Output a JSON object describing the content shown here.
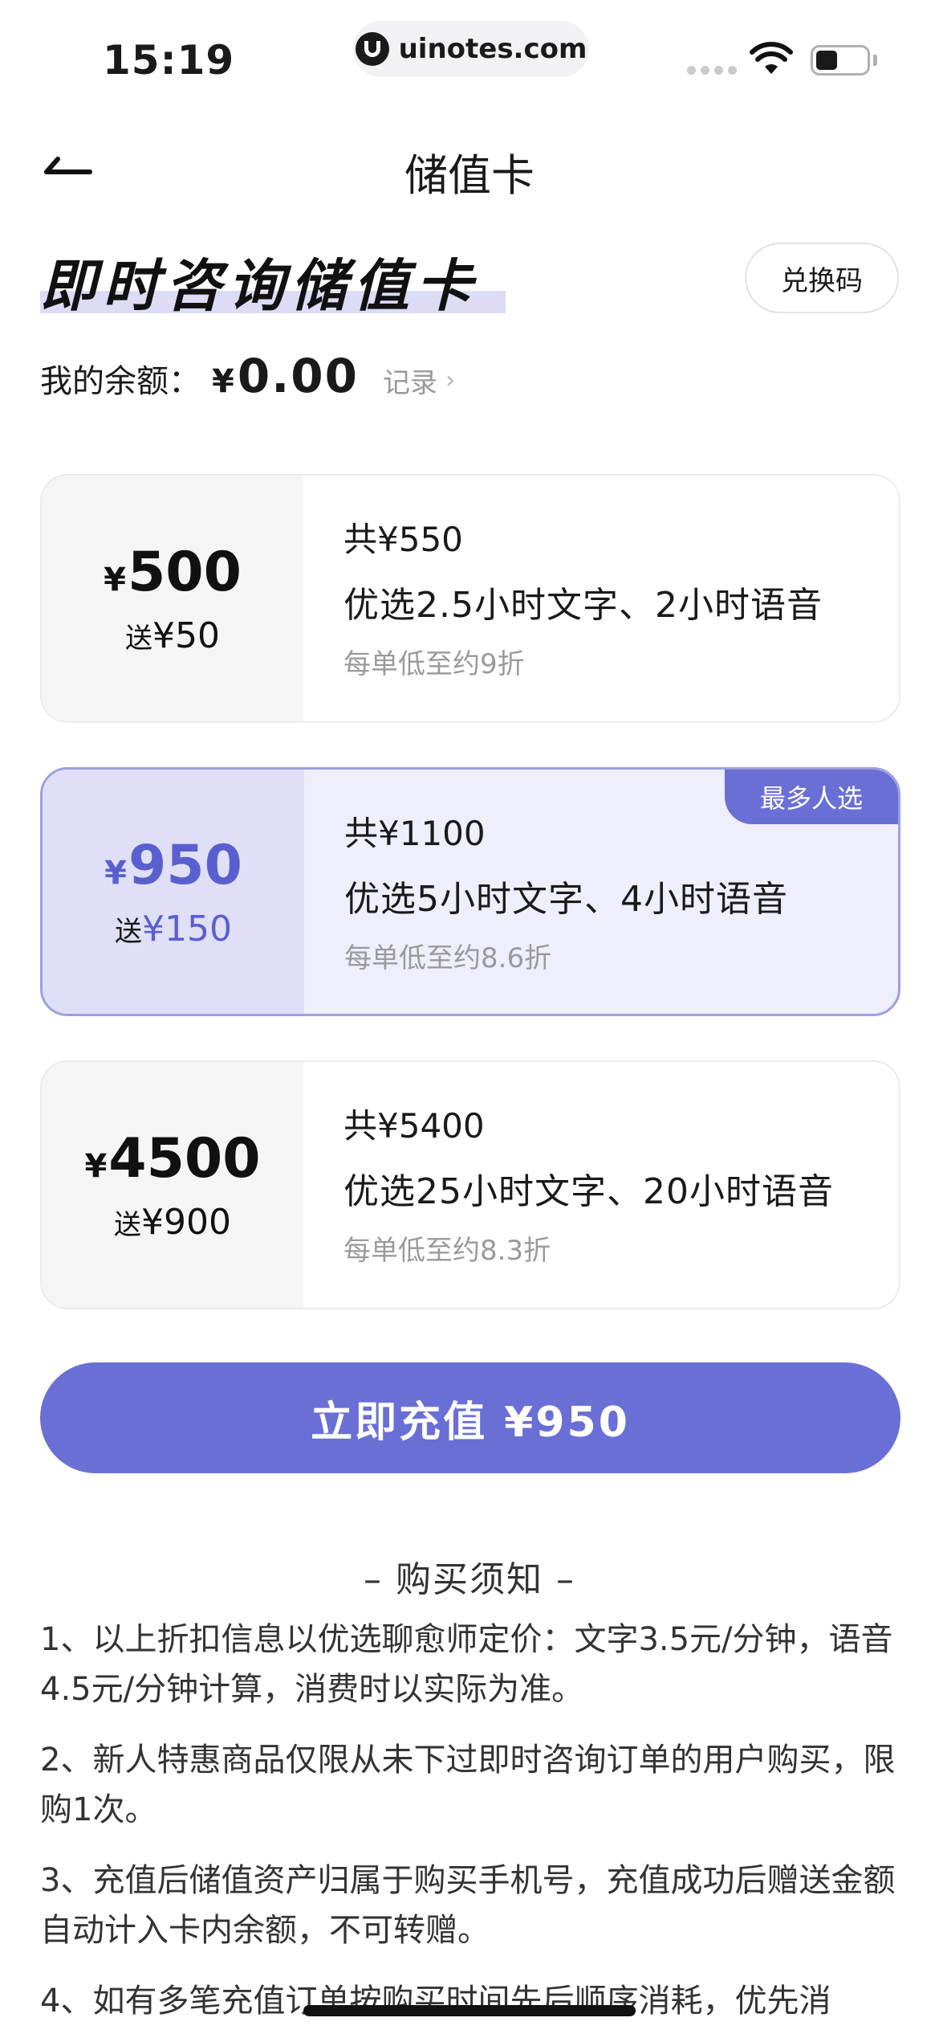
{
  "status_bar": {
    "time": "15:19",
    "url": "uinotes.com",
    "icons": [
      "cellular-signal-icon",
      "wifi-icon",
      "battery-icon"
    ]
  },
  "nav": {
    "back_icon": "back-arrow-icon",
    "title": "储值卡"
  },
  "header": {
    "card_title": "即时咨询储值卡",
    "redeem_label": "兑换码"
  },
  "balance": {
    "label": "我的余额：",
    "currency": "¥",
    "amount": "0.00",
    "record_label": "记录",
    "record_chevron": "›"
  },
  "packages": [
    {
      "currency": "¥",
      "price": "500",
      "bonus_prefix": "送",
      "bonus": "¥50",
      "total": "共¥550",
      "desc": "优选2.5小时文字、2小时语音",
      "note": "每单低至约9折",
      "selected": false
    },
    {
      "currency": "¥",
      "price": "950",
      "bonus_prefix": "送",
      "bonus": "¥150",
      "total": "共¥1100",
      "desc": "优选5小时文字、4小时语音",
      "note": "每单低至约8.6折",
      "selected": true,
      "badge": "最多人选"
    },
    {
      "currency": "¥",
      "price": "4500",
      "bonus_prefix": "送",
      "bonus": "¥900",
      "total": "共¥5400",
      "desc": "优选25小时文字、20小时语音",
      "note": "每单低至约8.3折",
      "selected": false
    }
  ],
  "pay_button": {
    "label": "立即充值 ¥950"
  },
  "notice": {
    "title": "– 购买须知 –",
    "items": [
      "1、以上折扣信息以优选聊愈师定价：文字3.5元/分钟，语音4.5元/分钟计算，消费时以实际为准。",
      "2、新人特惠商品仅限从未下过即时咨询订单的用户购买，限购1次。",
      "3、充值后储值资产归属于购买手机号，充值成功后赠送金额自动计入卡内余额，不可转赠。",
      "4、如有多笔充值订单按购买时间先后顺序消耗，优先消"
    ]
  },
  "colors": {
    "accent": "#6a6fd6",
    "selected_bg": "#eeeefc",
    "selected_border": "#9d9fdf",
    "title_highlight": "#dcdcf7"
  }
}
